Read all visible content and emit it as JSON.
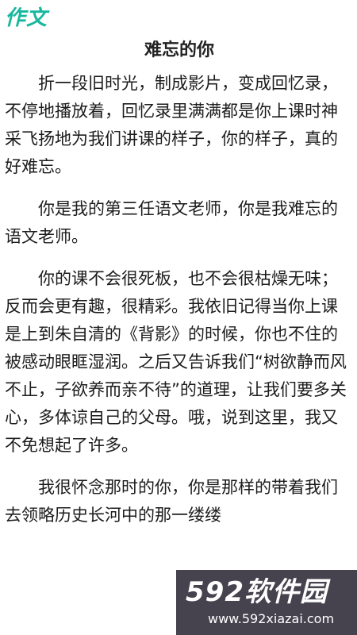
{
  "header": {
    "logo_text": "作文"
  },
  "article": {
    "title": "难忘的你",
    "paragraphs": [
      "折一段旧时光，制成影片，变成回忆录，不停地播放着，回忆录里满满都是你上课时神采飞扬地为我们讲课的样子，你的样子，真的好难忘。",
      "你是我的第三任语文老师，你是我难忘的语文老师。",
      "你的课不会很死板，也不会很枯燥无味；反而会更有趣，很精彩。我依旧记得当你上课是上到朱自清的《背影》的时候，你也不住的被感动眼眶湿润。之后又告诉我们“树欲静而风不止，子欲养而亲不待”的道理，让我们要多关心，多体谅自己的父母。哦，说到这里，我又不免想起了许多。",
      "我很怀念那时的你，你是那样的带着我们去领略历史长河中的那一缕缕"
    ]
  },
  "watermark": {
    "logo_text": "592软件园",
    "url": "www.592xiazai.com"
  }
}
